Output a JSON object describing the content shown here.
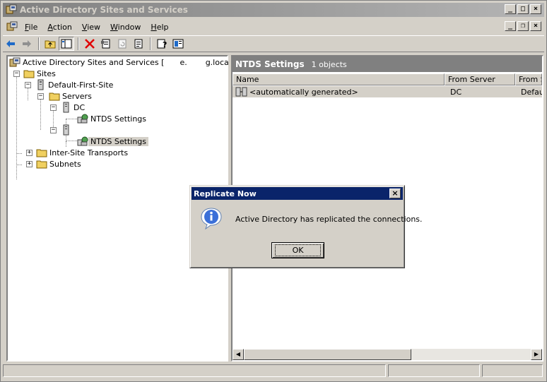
{
  "window": {
    "title": "Active Directory Sites and Services",
    "controls": {
      "minimize": "_",
      "maximize": "□",
      "close": "×"
    }
  },
  "menu": {
    "items": [
      "File",
      "Action",
      "View",
      "Window",
      "Help"
    ],
    "accelerators": [
      "F",
      "A",
      "V",
      "W",
      "H"
    ]
  },
  "toolbar": {
    "buttons": [
      "back-arrow-icon",
      "forward-arrow-icon",
      "up-folder-icon",
      "show-hide-tree-icon",
      "delete-icon",
      "properties-icon",
      "refresh-icon",
      "export-list-icon",
      "help-icon",
      "console-icon"
    ]
  },
  "tree": {
    "root": "Active Directory Sites and Services [",
    "root_suffix": "e.",
    "root_end": "g.local]",
    "sites": "Sites",
    "default_site": "Default-First-Site",
    "servers": "Servers",
    "server_dc": "DC",
    "ntds_1": "NTDS Settings",
    "server_2": "",
    "ntds_2": "NTDS Settings",
    "inter_site": "Inter-Site Transports",
    "subnets": "Subnets"
  },
  "list": {
    "header_title": "NTDS Settings",
    "header_count": "1 objects",
    "columns": [
      "Name",
      "From Server",
      "From S"
    ],
    "rows": [
      {
        "name": "<automatically generated>",
        "from_server": "DC",
        "from_site": "Defaul"
      }
    ]
  },
  "dialog": {
    "title": "Replicate Now",
    "close": "×",
    "message": "Active Directory has replicated the connections.",
    "ok": "OK",
    "icon": "information-icon",
    "title_color": "#0a246a"
  }
}
